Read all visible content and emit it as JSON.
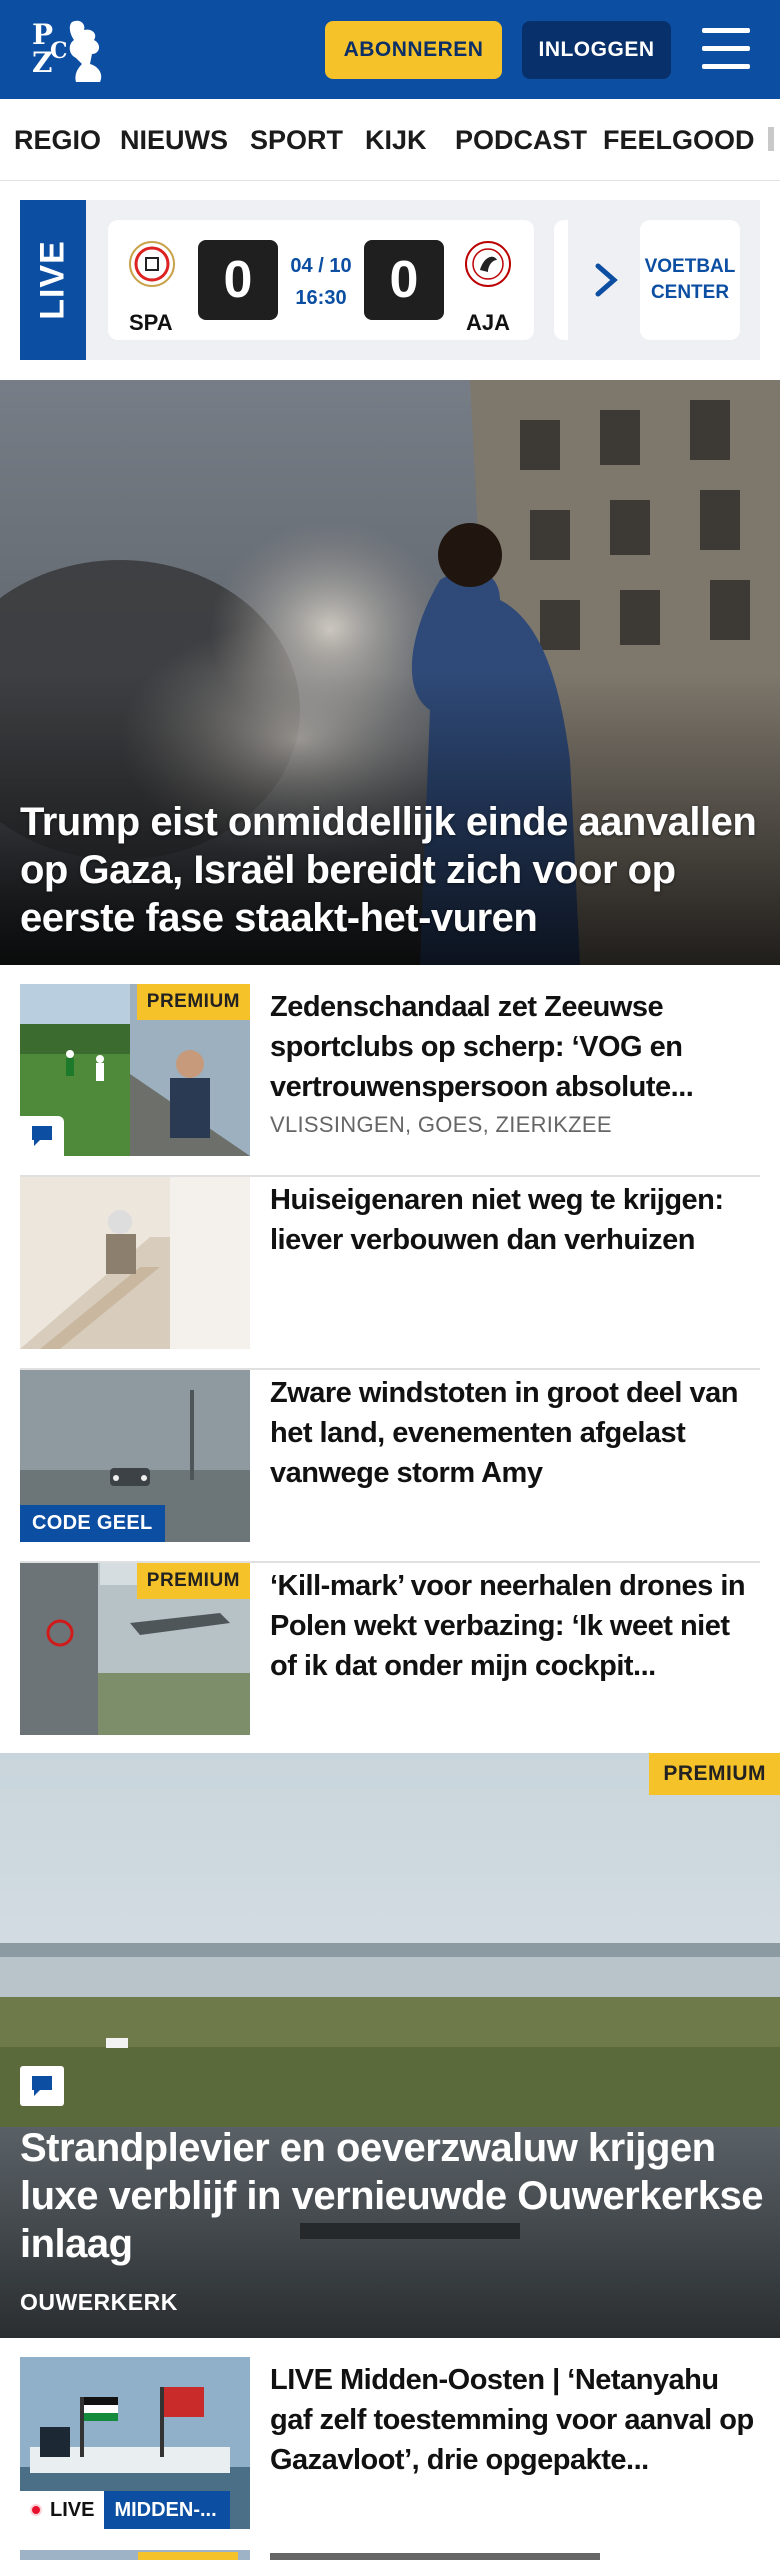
{
  "header": {
    "logo_text": "PZC",
    "subscribe_label": "ABONNEREN",
    "login_label": "INLOGGEN",
    "menu_icon": "hamburger-icon",
    "brand_color": "#0b4ea2",
    "accent_color": "#f6c229"
  },
  "nav": {
    "items": [
      "REGIO",
      "NIEUWS",
      "SPORT",
      "KIJK",
      "PODCAST",
      "FEELGOOD"
    ]
  },
  "live": {
    "tag": "LIVE",
    "match": {
      "home": "SPA",
      "away": "AJA",
      "home_score": "0",
      "away_score": "0",
      "date": "04 / 10",
      "time": "16:30"
    },
    "center_label_1": "VOETBAL",
    "center_label_2": "CENTER"
  },
  "hero": {
    "title": "Trump eist onmiddellijk einde aanvallen op Gaza, Israël bereidt zich voor op eerste fase staakt-het-vuren"
  },
  "articles": [
    {
      "title": "Zedenschandaal zet Zeeuwse sportclubs op scherp: ‘VOG en vertrouwenspersoon absolute...",
      "tags": "VLISSINGEN, GOES, ZIERIKZEE",
      "badge": "PREMIUM"
    },
    {
      "title": "Huiseigenaren niet weg te krijgen: liever verbouwen dan verhuizen"
    },
    {
      "title": "Zware windstoten in groot deel van het land, evenementen afgelast vanwege storm Amy",
      "badge": "CODE GEEL"
    },
    {
      "title": "‘Kill-mark’ voor neerhalen drones in Polen wekt verbazing: ‘Ik weet niet of ik dat onder mijn cockpit...",
      "badge": "PREMIUM"
    }
  ],
  "feature": {
    "title": "Strandplevier en oeverzwaluw krijgen luxe verblijf in vernieuwde Ouwerkerkse inlaag",
    "location": "OUWERKERK",
    "badge": "PREMIUM"
  },
  "live_article": {
    "title": "LIVE Midden-Oosten | ‘Netanyahu gaf zelf toestemming voor aanval op Gazavloot’, drie opgepakte...",
    "live_label": "LIVE",
    "topic": "MIDDEN-..."
  }
}
